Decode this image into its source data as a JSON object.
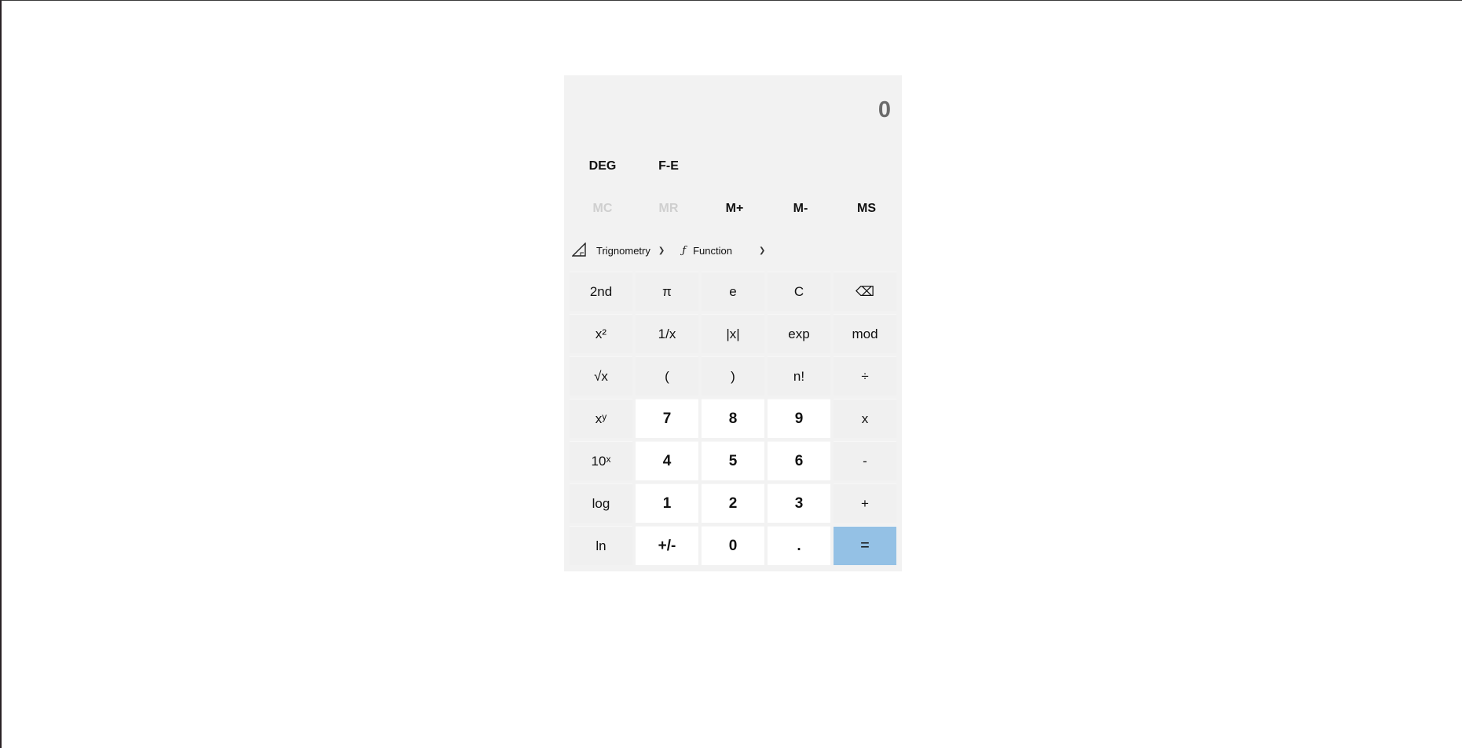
{
  "display": {
    "value": "0"
  },
  "modes": {
    "angle": "DEG",
    "notation": "F-E"
  },
  "memory": [
    {
      "label": "MC",
      "enabled": false
    },
    {
      "label": "MR",
      "enabled": false
    },
    {
      "label": "M+",
      "enabled": true
    },
    {
      "label": "M-",
      "enabled": true
    },
    {
      "label": "MS",
      "enabled": true
    }
  ],
  "menus": {
    "trig": {
      "label": "Trignometry",
      "icon": "triangle-ruler-icon"
    },
    "func": {
      "label": "Function",
      "icon": "function-icon"
    }
  },
  "keys": {
    "second": "2nd",
    "pi": "π",
    "e": "e",
    "clear": "C",
    "backspace": "⌫",
    "square": "x²",
    "reciprocal": "1/x",
    "abs": "|x|",
    "exp": "exp",
    "mod": "mod",
    "sqrt": "√x",
    "lparen": "(",
    "rparen": ")",
    "factorial": "n!",
    "divide": "÷",
    "power_base": "x",
    "power_sup": "y",
    "seven": "7",
    "eight": "8",
    "nine": "9",
    "multiply": "x",
    "ten_base": "10",
    "ten_sup": "x",
    "four": "4",
    "five": "5",
    "six": "6",
    "minus": "-",
    "log": "log",
    "one": "1",
    "two": "2",
    "three": "3",
    "plus": "+",
    "ln": "ln",
    "negate": "+/-",
    "zero": "0",
    "decimal": ".",
    "equals": "="
  },
  "colors": {
    "panel": "#f2f2f2",
    "key": "#f0f0f0",
    "digit_key": "#ffffff",
    "equals": "#94c1e5",
    "disabled_text": "#cfcfcf",
    "display_text": "#6b6b6b"
  }
}
